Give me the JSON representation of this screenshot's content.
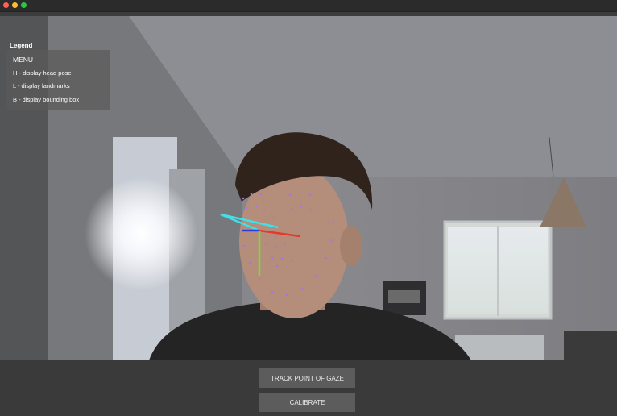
{
  "window": {
    "controls": [
      "close",
      "minimize",
      "maximize"
    ]
  },
  "legend": {
    "title": "Legend",
    "menu_label": "MENU",
    "items": [
      "H - display head pose",
      "L - display landmarks",
      "B - display bounding box"
    ]
  },
  "pose_axes": {
    "colors": {
      "cyan": "#3fe0e8",
      "red": "#e53a2a",
      "green": "#6fe12e",
      "blue": "#2a3be0"
    }
  },
  "landmark_color": "#b070e0",
  "buttons": {
    "track_label": "TRACK POINT OF GAZE",
    "calibrate_label": "CALIBRATE"
  }
}
